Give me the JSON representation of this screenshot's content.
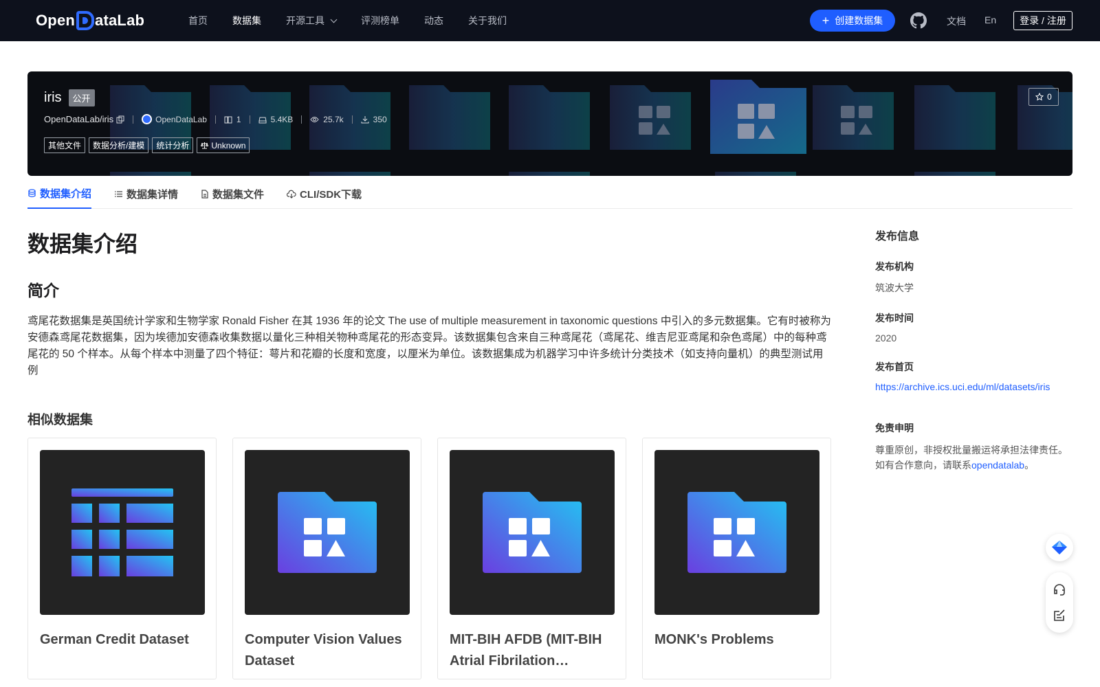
{
  "nav": {
    "logo_prefix": "Open",
    "logo_suffix": "ataLab",
    "links": [
      "首页",
      "数据集",
      "开源工具",
      "评测榜单",
      "动态",
      "关于我们"
    ],
    "create_label": "创建数据集",
    "docs_label": "文档",
    "lang_label": "En",
    "login_label": "登录 / 注册"
  },
  "dataset": {
    "name": "iris",
    "visibility": "公开",
    "path": "OpenDataLab/iris",
    "org": "OpenDataLab",
    "files": "1",
    "size": "5.4KB",
    "views": "25.7k",
    "downloads": "350",
    "tags": [
      "其他文件",
      "数据分析/建模",
      "统计分析"
    ],
    "license": "Unknown",
    "stars": "0"
  },
  "tabs": [
    "数据集介绍",
    "数据集详情",
    "数据集文件",
    "CLI/SDK下载"
  ],
  "main": {
    "heading": "数据集介绍",
    "subheading": "简介",
    "intro": "鸢尾花数据集是英国统计学家和生物学家 Ronald Fisher 在其 1936 年的论文 The use of multiple measurement in taxonomic questions 中引入的多元数据集。它有时被称为安德森鸢尾花数据集，因为埃德加安德森收集数据以量化三种相关物种鸢尾花的形态变异。该数据集包含来自三种鸢尾花（鸢尾花、维吉尼亚鸢尾和杂色鸢尾）中的每种鸢尾花的 50 个样本。从每个样本中测量了四个特征：萼片和花瓣的长度和宽度，以厘米为单位。该数据集成为机器学习中许多统计分类技术（如支持向量机）的典型测试用例",
    "similar_heading": "相似数据集",
    "similar": [
      {
        "name": "German Credit Dataset",
        "icon": "table-icon"
      },
      {
        "name": "Computer Vision Values Dataset",
        "icon": "folder-icon"
      },
      {
        "name": "MIT-BIH AFDB (MIT-BIH Atrial Fibrilation…",
        "icon": "folder-icon"
      },
      {
        "name": "MONK's Problems",
        "icon": "folder-icon"
      }
    ]
  },
  "side": {
    "heading": "发布信息",
    "org_label": "发布机构",
    "org_value": "筑波大学",
    "time_label": "发布时间",
    "time_value": "2020",
    "home_label": "发布首页",
    "home_value": "https://archive.ics.uci.edu/ml/datasets/iris",
    "disclaimer_label": "免责申明",
    "disclaimer_line1": "尊重原创，非授权批量搬运将承担法律责任。",
    "disclaimer_line2_prefix": "如有合作意向，请联系",
    "disclaimer_link": "opendatalab",
    "disclaimer_line2_suffix": "。"
  },
  "colors": {
    "nav_bg": "#0d111c",
    "accent": "#1f5eff",
    "banner_bg": "#0b0d12",
    "card_thumb_bg": "#232323"
  }
}
